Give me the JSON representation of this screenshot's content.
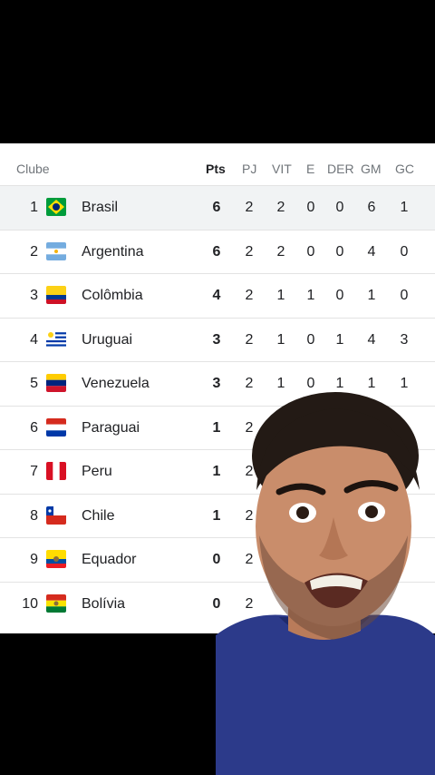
{
  "table": {
    "headers": {
      "club": "Clube",
      "pts": "Pts",
      "pj": "PJ",
      "vit": "VIT",
      "e": "E",
      "der": "DER",
      "gm": "GM",
      "gc": "GC"
    },
    "rows": [
      {
        "pos": "1",
        "team": "Brasil",
        "pts": "6",
        "pj": "2",
        "vit": "2",
        "e": "0",
        "der": "0",
        "gm": "6",
        "gc": "1",
        "flag": "brasil-flag-icon"
      },
      {
        "pos": "2",
        "team": "Argentina",
        "pts": "6",
        "pj": "2",
        "vit": "2",
        "e": "0",
        "der": "0",
        "gm": "4",
        "gc": "0",
        "flag": "argentina-flag-icon"
      },
      {
        "pos": "3",
        "team": "Colômbia",
        "pts": "4",
        "pj": "2",
        "vit": "1",
        "e": "1",
        "der": "0",
        "gm": "1",
        "gc": "0",
        "flag": "colombia-flag-icon"
      },
      {
        "pos": "4",
        "team": "Uruguai",
        "pts": "3",
        "pj": "2",
        "vit": "1",
        "e": "0",
        "der": "1",
        "gm": "4",
        "gc": "3",
        "flag": "uruguai-flag-icon"
      },
      {
        "pos": "5",
        "team": "Venezuela",
        "pts": "3",
        "pj": "2",
        "vit": "1",
        "e": "0",
        "der": "1",
        "gm": "1",
        "gc": "1",
        "flag": "venezuela-flag-icon"
      },
      {
        "pos": "6",
        "team": "Paraguai",
        "pts": "1",
        "pj": "2",
        "flag": "paraguai-flag-icon"
      },
      {
        "pos": "7",
        "team": "Peru",
        "pts": "1",
        "pj": "2",
        "flag": "peru-flag-icon"
      },
      {
        "pos": "8",
        "team": "Chile",
        "pts": "1",
        "pj": "2",
        "flag": "chile-flag-icon"
      },
      {
        "pos": "9",
        "team": "Equador",
        "pts": "0",
        "pj": "2",
        "flag": "equador-flag-icon"
      },
      {
        "pos": "10",
        "team": "Bolívia",
        "pts": "0",
        "pj": "2",
        "flag": "bolivia-flag-icon"
      }
    ]
  }
}
